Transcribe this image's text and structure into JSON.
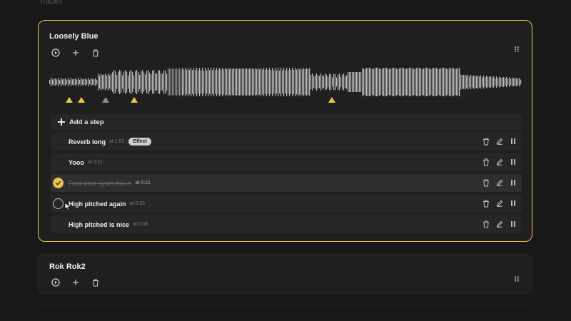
{
  "page": {
    "top_label": "Tracks"
  },
  "tracks": [
    {
      "name": "Loosely Blue",
      "selected": true,
      "tools": [
        "play-icon",
        "add-icon",
        "trash-icon"
      ],
      "markers": [
        {
          "at": "0:05",
          "active": true
        },
        {
          "at": "0:08",
          "active": true
        },
        {
          "at": "0:14",
          "active": false
        },
        {
          "at": "0:21",
          "active": true
        },
        {
          "at": "1:10",
          "active": true
        }
      ],
      "add_step_label": "Add a step",
      "steps": [
        {
          "name": "Reverb long",
          "time": "at 1:51",
          "badge": "Effect",
          "done": false,
          "show_check": false
        },
        {
          "name": "Yooo",
          "time": "at 0:11",
          "badge": "",
          "done": false,
          "show_check": false
        },
        {
          "name": "Find what synth this is",
          "time": "at 0:21",
          "badge": "",
          "done": true,
          "show_check": true
        },
        {
          "name": "High pitched again",
          "time": "at 0:33",
          "badge": "",
          "done": false,
          "show_check": true
        },
        {
          "name": "High pitched is nice",
          "time": "at 0:06",
          "badge": "",
          "done": false,
          "show_check": false
        }
      ]
    },
    {
      "name": "Rok Rok2",
      "selected": false,
      "tools": [
        "play-icon",
        "add-icon",
        "trash-icon"
      ]
    }
  ],
  "colors": {
    "accent": "#e8c547",
    "background": "#181818",
    "card": "#1f1f1f",
    "row": "#262626"
  }
}
